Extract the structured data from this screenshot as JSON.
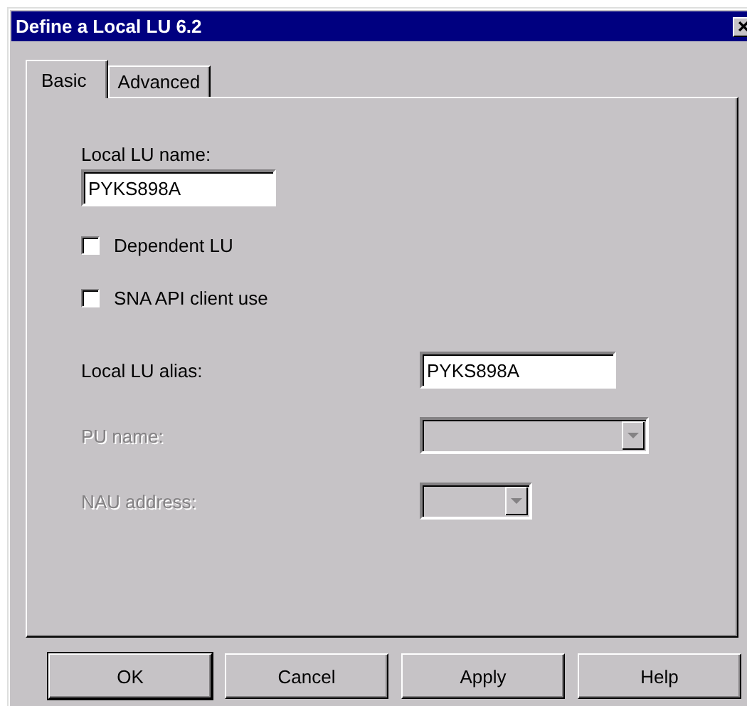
{
  "window": {
    "title": "Define a Local LU 6.2"
  },
  "tabs": [
    {
      "label": "Basic",
      "selected": true
    },
    {
      "label": "Advanced",
      "selected": false
    }
  ],
  "fields": [
    {
      "kind": "text",
      "label": "Local LU name:",
      "value": "PYKS898A",
      "disabled": false
    },
    {
      "kind": "checkbox",
      "label": "Dependent LU",
      "checked": false,
      "disabled": false
    },
    {
      "kind": "checkbox",
      "label": "SNA API client use",
      "checked": false,
      "disabled": false
    },
    {
      "kind": "text-row",
      "label": "Local LU alias:",
      "value": "PYKS898A",
      "disabled": false
    },
    {
      "kind": "combo-row",
      "label": "PU name:",
      "disabled": true
    },
    {
      "kind": "combo-row",
      "label": "NAU address:",
      "disabled": true
    }
  ],
  "buttons": [
    {
      "label": "OK",
      "default": true
    },
    {
      "label": "Cancel",
      "default": false
    },
    {
      "label": "Apply",
      "default": false
    },
    {
      "label": "Help",
      "default": false
    }
  ]
}
